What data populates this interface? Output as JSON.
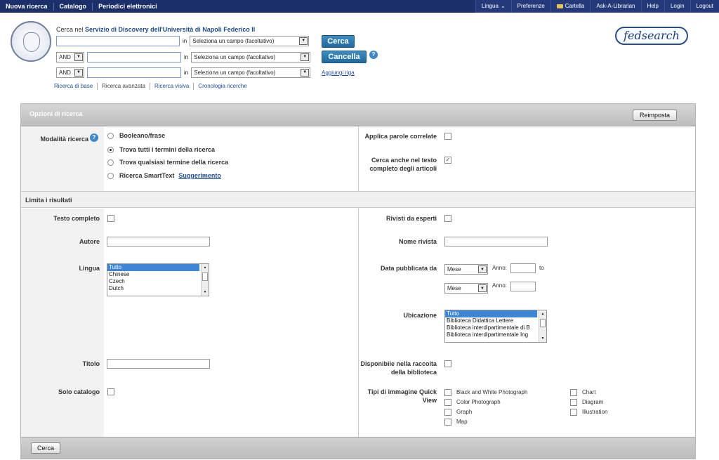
{
  "topbar": {
    "left": [
      "Nuova ricerca",
      "Catalogo",
      "Periodici elettronici"
    ],
    "lingua": "Lingua",
    "preferenze": "Preferenze",
    "cartella": "Cartella",
    "ask": "Ask-A-Librarian",
    "help": "Help",
    "login": "Login",
    "logout": "Logout"
  },
  "brand": {
    "fedsearch": "fedsearch"
  },
  "search": {
    "prefix": "Cerca nel",
    "service": "Servizio di Discovery dell'Università di Napoli Federico II",
    "in_label": "in",
    "field_placeholder": "Seleziona un campo (facoltativo)",
    "bool1": "AND",
    "bool2": "AND",
    "search_btn": "Cerca",
    "clear_btn": "Cancella",
    "add_row": "Aggiungi riga",
    "links": [
      "Ricerca di base",
      "Ricerca avanzata",
      "Ricerca visiva",
      "Cronologia ricerche"
    ]
  },
  "options": {
    "title": "Opzioni di ricerca",
    "reset": "Reimposta",
    "mode_label": "Modalità ricerca",
    "modes": [
      "Booleano/frase",
      "Trova tutti i termini della ricerca",
      "Trova qualsiasi termine della ricerca",
      "Ricerca SmartText"
    ],
    "selected_mode": 1,
    "hint": "Suggerimento",
    "related_words": "Applica parole correlate",
    "related_checked": false,
    "fulltext_search": "Cerca anche nel testo completo degli articoli",
    "fulltext_search_checked": true
  },
  "limits": {
    "title": "Limita i risultati",
    "full_text": "Testo completo",
    "author": "Autore",
    "language": "Lingua",
    "languages": [
      "Tutto",
      "Chinese",
      "Czech",
      "Dutch"
    ],
    "title_label": "Titolo",
    "catalog_only": "Solo catalogo",
    "peer_reviewed": "Rivisti da esperti",
    "journal_name": "Nome rivista",
    "pub_date": "Data pubblicata da",
    "month": "Mese",
    "year": "Anno:",
    "to": "to",
    "location": "Ubicazione",
    "locations": [
      "Tutto",
      "Biblioteca Didattica Lettere",
      "Biblioteca interdipartimentale di B",
      "Biblioteca interdipartimentale Ing"
    ],
    "available": "Disponibile nella raccolta della biblioteca",
    "image_types_label": "Tipi di immagine Quick View",
    "image_types_col1": [
      "Black and White Photograph",
      "Color Photograph",
      "Graph",
      "Map"
    ],
    "image_types_col2": [
      "Chart",
      "Diagram",
      "Illustration"
    ]
  },
  "footer": {
    "search_btn": "Cerca"
  }
}
